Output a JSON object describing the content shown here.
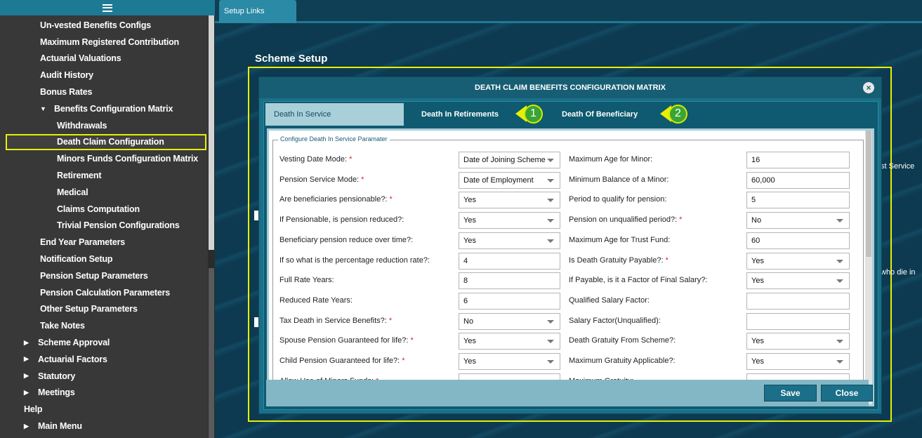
{
  "sidebar": {
    "items": [
      {
        "label": "Un-vested Benefits Configs",
        "level": 2
      },
      {
        "label": "Maximum Registered Contribution",
        "level": 2
      },
      {
        "label": "Actuarial Valuations",
        "level": 2
      },
      {
        "label": "Audit History",
        "level": 2
      },
      {
        "label": "Bonus Rates",
        "level": 2
      },
      {
        "label": "Benefits Configuration Matrix",
        "level": 2,
        "expanded": true
      },
      {
        "label": "Withdrawals",
        "level": 3
      },
      {
        "label": "Death Claim Configuration",
        "level": 3,
        "active": true
      },
      {
        "label": "Minors Funds Configuration Matrix",
        "level": 3
      },
      {
        "label": "Retirement",
        "level": 3
      },
      {
        "label": "Medical",
        "level": 3
      },
      {
        "label": "Claims Computation",
        "level": 3
      },
      {
        "label": "Trivial Pension Configurations",
        "level": 3
      },
      {
        "label": "End Year Parameters",
        "level": 2
      },
      {
        "label": "Notification Setup",
        "level": 2
      },
      {
        "label": "Pension Setup Parameters",
        "level": 2
      },
      {
        "label": "Pension Calculation Parameters",
        "level": 2
      },
      {
        "label": "Other Setup Parameters",
        "level": 2
      },
      {
        "label": "Take Notes",
        "level": 2
      },
      {
        "label": "Scheme Approval",
        "level": 1,
        "collapsed": true
      },
      {
        "label": "Actuarial Factors",
        "level": 1,
        "collapsed": true
      },
      {
        "label": "Statutory",
        "level": 1,
        "collapsed": true
      },
      {
        "label": "Meetings",
        "level": 1,
        "collapsed": true
      },
      {
        "label": "Help",
        "level": 1
      },
      {
        "label": "Main Menu",
        "level": 1,
        "collapsed": true
      }
    ]
  },
  "main": {
    "tab_label": "Setup Links",
    "section_title": "Scheme Setup",
    "bg_text_1": "st Service",
    "bg_text_2": "who die in"
  },
  "modal": {
    "title": "DEATH CLAIM BENEFITS CONFIGURATION MATRIX",
    "close_icon": "×",
    "tabs": [
      "Death In Service",
      "Death In Retirements",
      "Death Of Beneficiary"
    ],
    "callouts": [
      "1",
      "2"
    ],
    "legend": "Configure Death In Service Paramater",
    "left_rows": [
      {
        "label": "Vesting Date Mode:",
        "required": true,
        "value": "Date of Joining Scheme",
        "type": "select"
      },
      {
        "label": "Pension Service Mode:",
        "required": true,
        "value": "Date of Employment",
        "type": "select"
      },
      {
        "label": "Are beneficiaries pensionable?:",
        "required": true,
        "value": "Yes",
        "type": "select"
      },
      {
        "label": "If Pensionable, is pension reduced?:",
        "required": false,
        "value": "Yes",
        "type": "select"
      },
      {
        "label": "Beneficiary pension reduce over time?:",
        "required": false,
        "value": "Yes",
        "type": "select"
      },
      {
        "label": "If so what is the percentage reduction rate?:",
        "required": false,
        "value": "4",
        "type": "input"
      },
      {
        "label": "Full Rate Years:",
        "required": false,
        "value": "8",
        "type": "input"
      },
      {
        "label": "Reduced Rate Years:",
        "required": false,
        "value": "6",
        "type": "input"
      },
      {
        "label": "Tax Death in Service Benefits?:",
        "required": true,
        "value": "No",
        "type": "select"
      },
      {
        "label": "Spouse Pension Guaranteed for life?:",
        "required": true,
        "value": "Yes",
        "type": "select"
      },
      {
        "label": "Child Pension Guaranteed for life?:",
        "required": true,
        "value": "Yes",
        "type": "select"
      },
      {
        "label": "Allow Use of Minors Funds:",
        "required": true,
        "value": "",
        "type": "select"
      }
    ],
    "right_rows": [
      {
        "label": "Maximum Age for Minor:",
        "required": false,
        "value": "16",
        "type": "input"
      },
      {
        "label": "Minimum Balance of a Minor:",
        "required": false,
        "value": "60,000",
        "type": "input"
      },
      {
        "label": "Period to qualify for pension:",
        "required": false,
        "value": "5",
        "type": "input"
      },
      {
        "label": "Pension on unqualified period?:",
        "required": true,
        "value": "No",
        "type": "select"
      },
      {
        "label": "Maximum Age for Trust Fund:",
        "required": false,
        "value": "60",
        "type": "input"
      },
      {
        "label": "Is Death Gratuity Payable?:",
        "required": true,
        "value": "Yes",
        "type": "select"
      },
      {
        "label": "If Payable, is it a Factor of Final Salary?:",
        "required": false,
        "value": "Yes",
        "type": "select"
      },
      {
        "label": "Qualified Salary Factor:",
        "required": false,
        "value": "",
        "type": "input"
      },
      {
        "label": "Salary Factor(Unqualified):",
        "required": false,
        "value": "",
        "type": "input"
      },
      {
        "label": "Death Gratuity From Scheme?:",
        "required": false,
        "value": "Yes",
        "type": "select"
      },
      {
        "label": "Maximum Gratuity Applicable?:",
        "required": false,
        "value": "Yes",
        "type": "select"
      },
      {
        "label": "Maximum Gratuity:",
        "required": false,
        "value": "",
        "type": "input"
      }
    ],
    "save_label": "Save",
    "close_label": "Close"
  }
}
